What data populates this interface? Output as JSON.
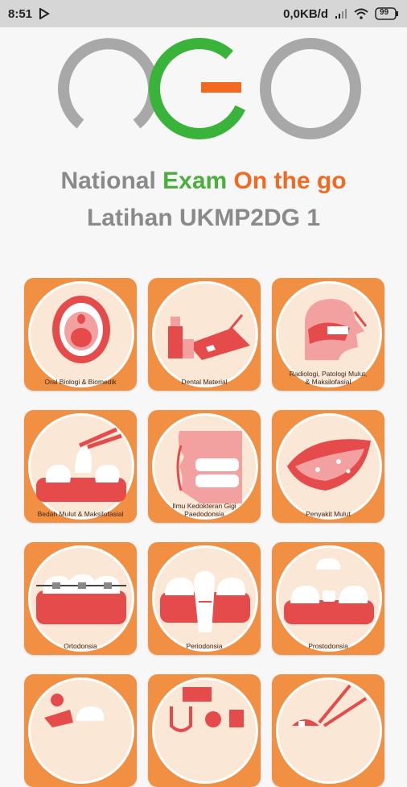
{
  "status_bar": {
    "time": "8:51",
    "network_speed": "0,0KB/d",
    "battery": "99"
  },
  "header": {
    "title_part1": "National ",
    "title_highlight": "Exam",
    "title_part2": " On the go",
    "subtitle": "Latihan UKMP2DG 1"
  },
  "colors": {
    "accent_orange": "#f18f43",
    "logo_green": "#3ab33a",
    "logo_orange": "#f26a22",
    "logo_gray": "#a8a8a8"
  },
  "categories": [
    {
      "label": "Oral Biologi & Biomedik",
      "icon": "open-mouth-icon"
    },
    {
      "label": "Dental Material",
      "icon": "dental-material-icon"
    },
    {
      "label": "Radiologi, Patologi Mulut,\n& Maksilofasial",
      "icon": "head-xray-icon"
    },
    {
      "label": "Bedah Mulut & Maksilofasial",
      "icon": "tooth-extraction-icon"
    },
    {
      "label": "Ilmu Kedokteran Gigi\nPaedodonsia",
      "icon": "child-teeth-icon"
    },
    {
      "label": "Penyakit Mulut",
      "icon": "lips-icon"
    },
    {
      "label": "Ortodonsia",
      "icon": "braces-icon"
    },
    {
      "label": "Periodonsia",
      "icon": "gum-tooth-icon"
    },
    {
      "label": "Prostodonsia",
      "icon": "denture-icon"
    },
    {
      "label": "",
      "icon": "dentist-icon"
    },
    {
      "label": "",
      "icon": "dental-tools-icon"
    },
    {
      "label": "",
      "icon": "endo-tools-icon"
    }
  ]
}
